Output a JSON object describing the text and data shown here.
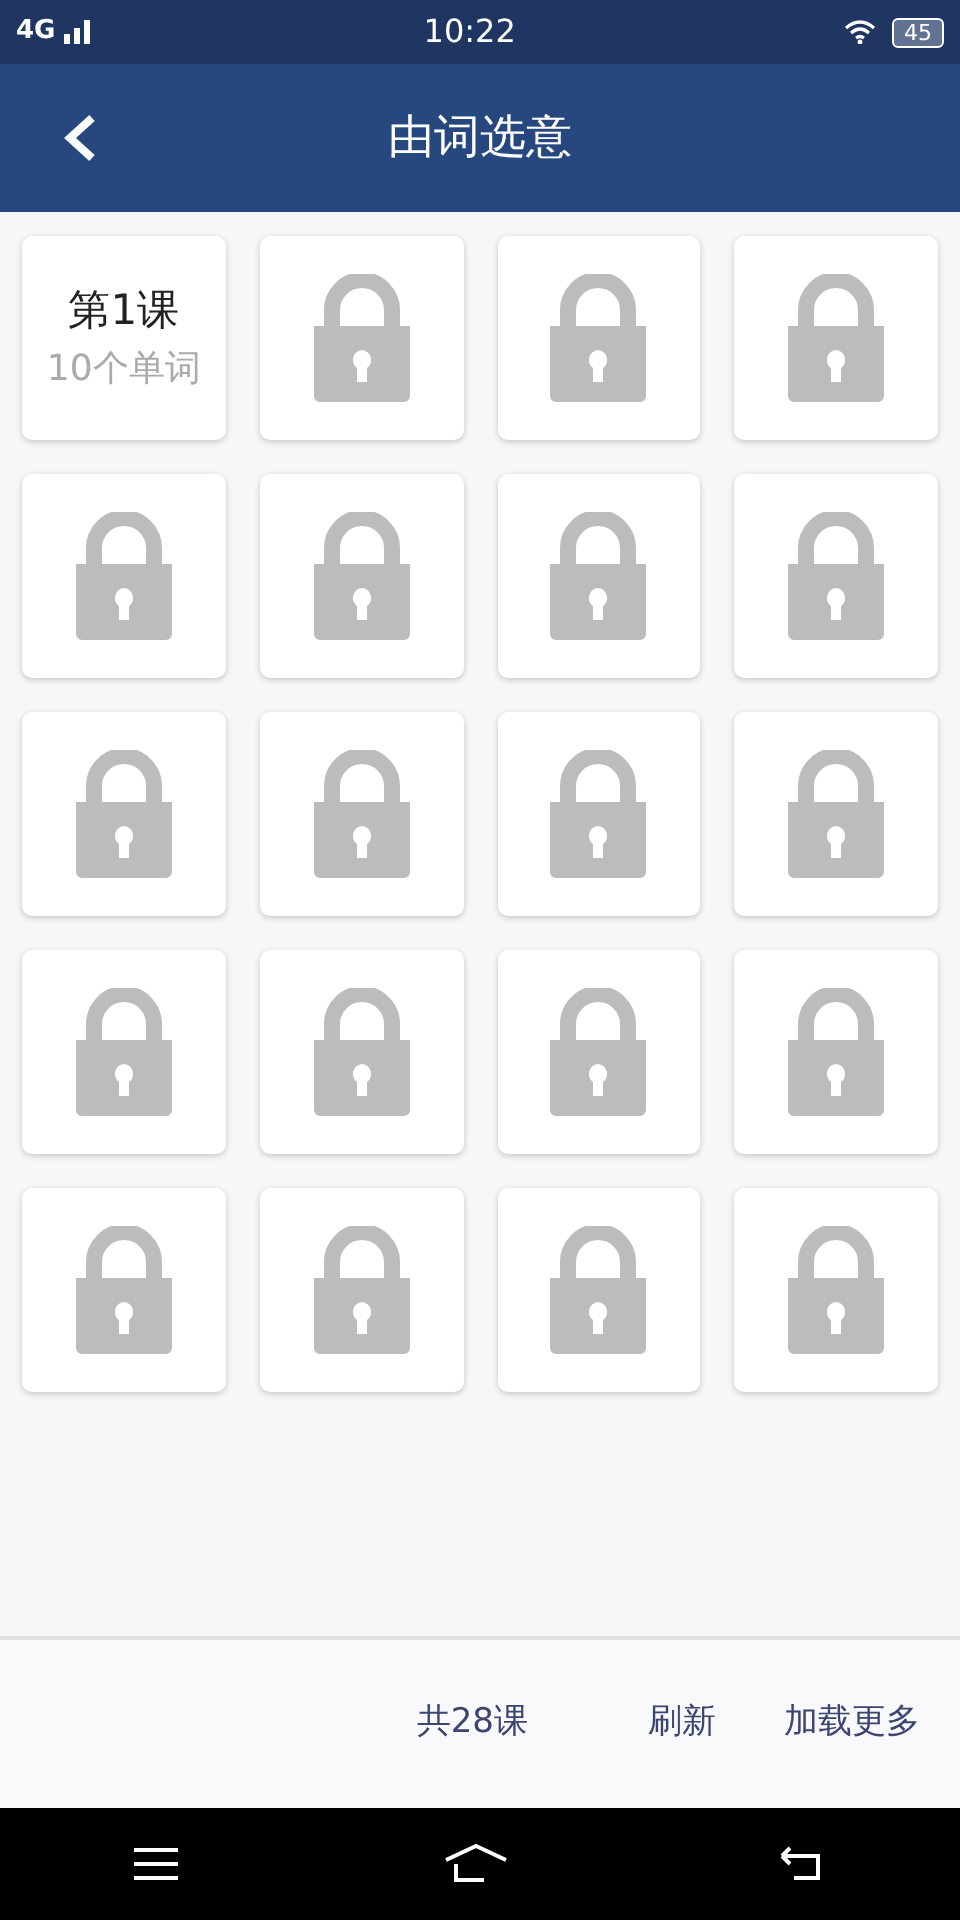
{
  "status_bar": {
    "network": "4G",
    "time": "10:22",
    "battery": "45"
  },
  "app_bar": {
    "title": "由词选意"
  },
  "lessons": [
    {
      "kind": "lesson",
      "title": "第1课",
      "subtitle": "10个单词"
    },
    {
      "kind": "locked"
    },
    {
      "kind": "locked"
    },
    {
      "kind": "locked"
    },
    {
      "kind": "locked"
    },
    {
      "kind": "locked"
    },
    {
      "kind": "locked"
    },
    {
      "kind": "locked"
    },
    {
      "kind": "locked"
    },
    {
      "kind": "locked"
    },
    {
      "kind": "locked"
    },
    {
      "kind": "locked"
    },
    {
      "kind": "locked"
    },
    {
      "kind": "locked"
    },
    {
      "kind": "locked"
    },
    {
      "kind": "locked"
    },
    {
      "kind": "locked"
    },
    {
      "kind": "locked"
    },
    {
      "kind": "locked"
    },
    {
      "kind": "locked"
    }
  ],
  "footer": {
    "total": "共28课",
    "refresh": "刷新",
    "load_more": "加载更多"
  }
}
